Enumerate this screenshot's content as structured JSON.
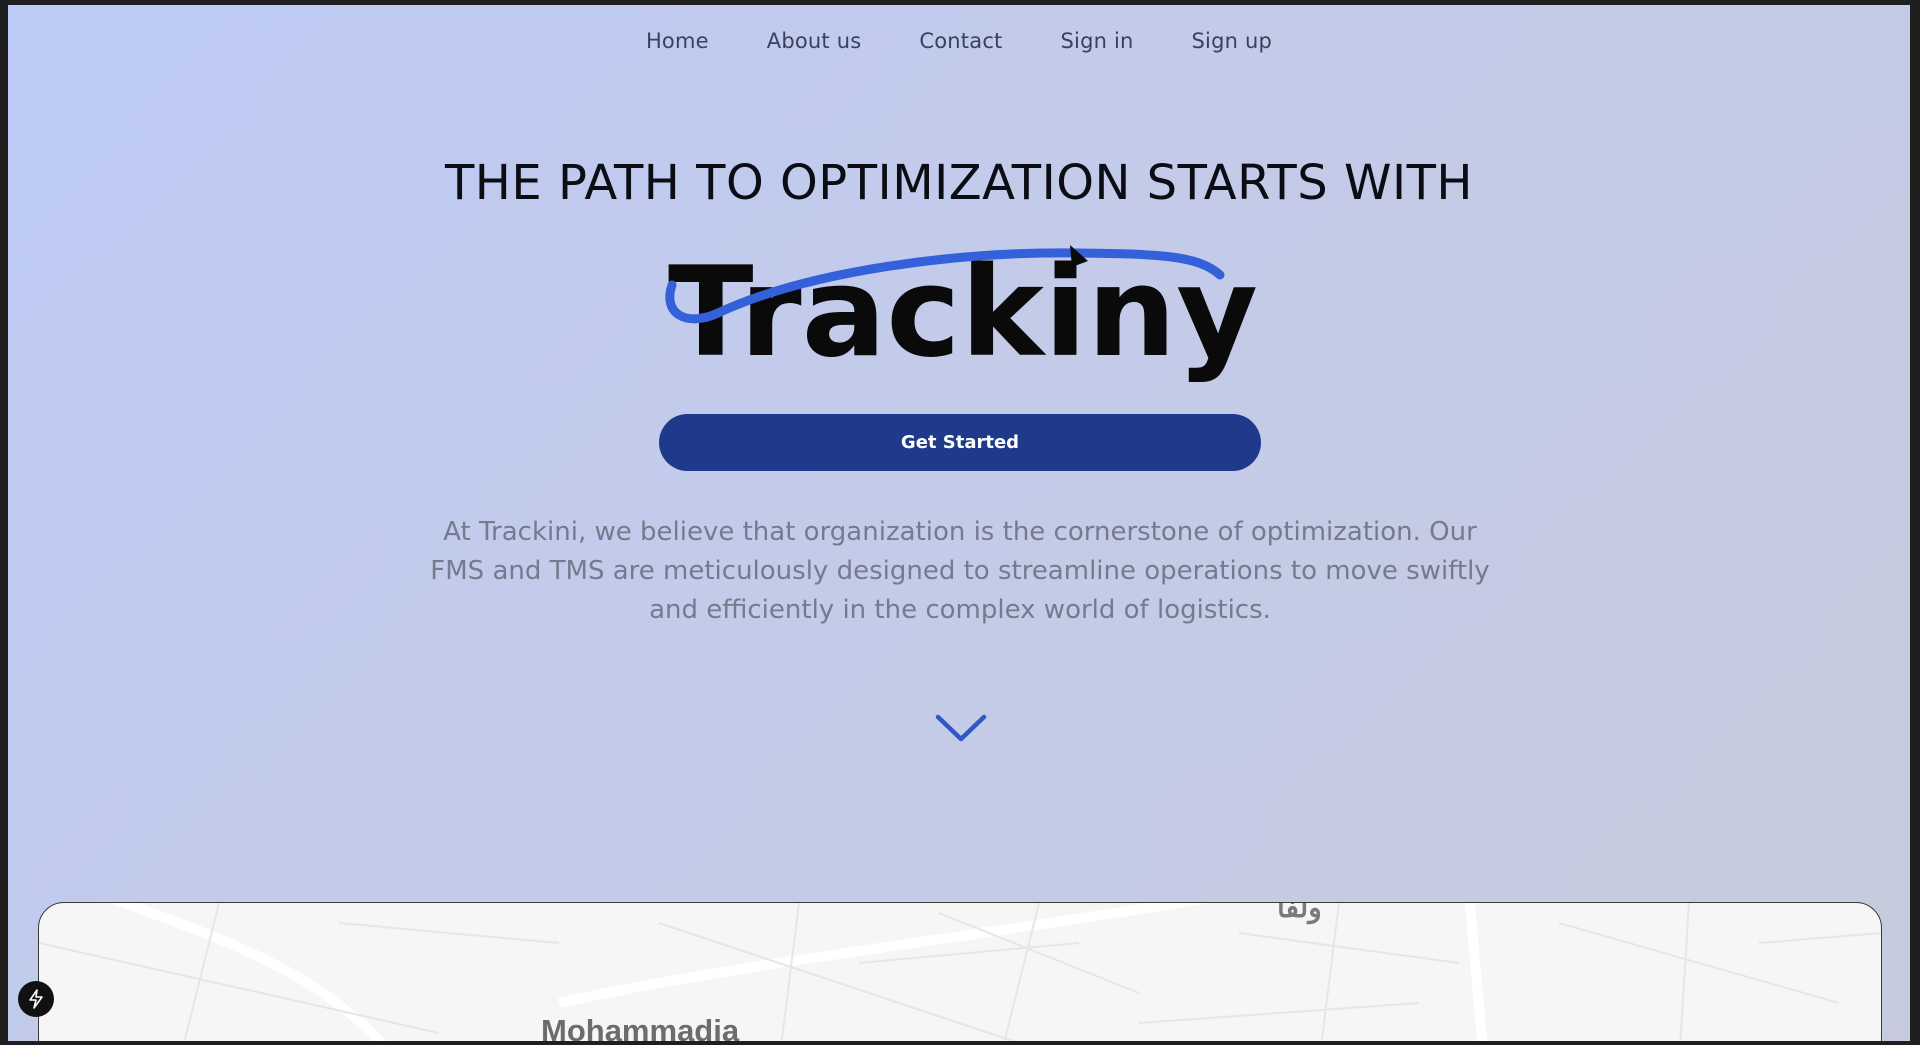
{
  "nav": {
    "items": [
      {
        "label": "Home",
        "name": "nav-home"
      },
      {
        "label": "About us",
        "name": "nav-about-us"
      },
      {
        "label": "Contact",
        "name": "nav-contact"
      },
      {
        "label": "Sign in",
        "name": "nav-sign-in"
      },
      {
        "label": "Sign up",
        "name": "nav-sign-up"
      }
    ]
  },
  "hero": {
    "headline": "THE PATH TO OPTIMIZATION STARTS WITH",
    "logo_text": "Trackiny",
    "cta_label": "Get Started",
    "description": "At Trackini, we believe that organization is the cornerstone of optimization. Our FMS and TMS are meticulously designed to streamline operations to move swiftly and efficiently in the complex world of logistics."
  },
  "map": {
    "city_label": "Mohammadia",
    "top_label": "ولفا"
  },
  "icons": {
    "scroll": "chevron-down-icon",
    "floating": "bolt-icon"
  },
  "colors": {
    "accent": "#1f3a8a",
    "logo_swoosh": "#3461d9",
    "text_muted": "#767a8d"
  }
}
